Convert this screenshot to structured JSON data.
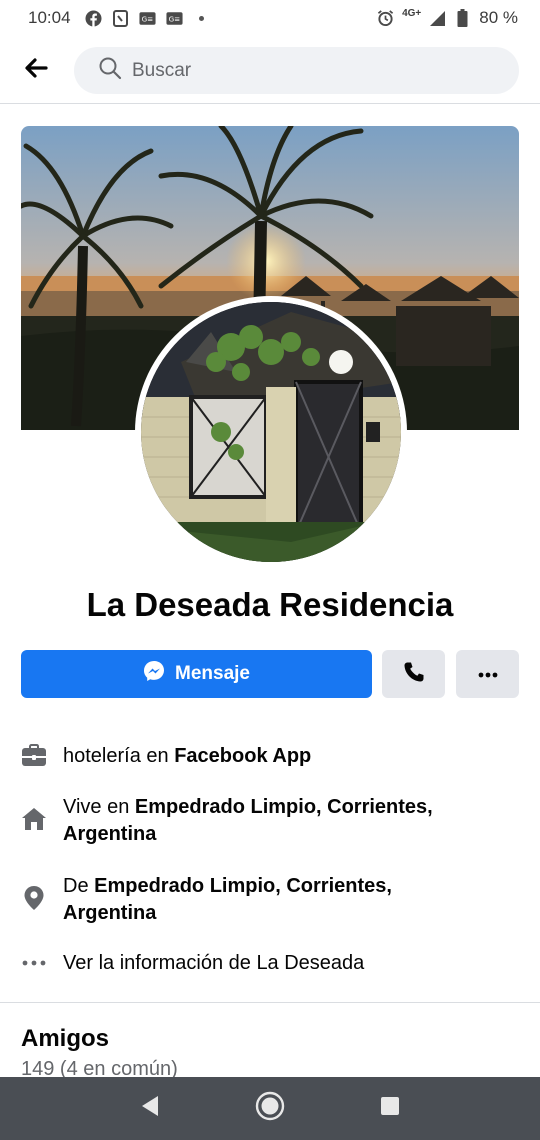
{
  "status_bar": {
    "time": "10:04",
    "network": "4G+",
    "battery": "80 %"
  },
  "search": {
    "placeholder": "Buscar"
  },
  "page": {
    "name": "La Deseada Residencia"
  },
  "actions": {
    "message_label": "Mensaje"
  },
  "info": {
    "category_prefix": "hotelería en ",
    "category_value": "Facebook App",
    "lives_prefix": "Vive en ",
    "lives_value_line1": "Empedrado Limpio, Corrientes,",
    "lives_value_line2": "Argentina",
    "from_prefix": "De ",
    "from_value_line1": "Empedrado Limpio, Corrientes,",
    "from_value_line2": "Argentina",
    "see_info": "Ver la información de La Deseada"
  },
  "friends": {
    "title": "Amigos",
    "count": "149 (4 en común)"
  },
  "colors": {
    "accent": "#1877f2",
    "secondary_button": "#e4e6eb",
    "search_bg": "#f0f2f5",
    "nav_bar": "#4a4e54"
  },
  "icons": [
    "facebook-icon",
    "nfc-icon",
    "mail-icon",
    "mail-icon",
    "alarm-icon",
    "signal-icon",
    "battery-icon",
    "back-arrow-icon",
    "search-icon",
    "messenger-icon",
    "phone-icon",
    "more-icon",
    "briefcase-icon",
    "home-icon",
    "location-pin-icon",
    "more-dots-icon",
    "nav-back-icon",
    "nav-home-icon",
    "nav-recents-icon"
  ]
}
